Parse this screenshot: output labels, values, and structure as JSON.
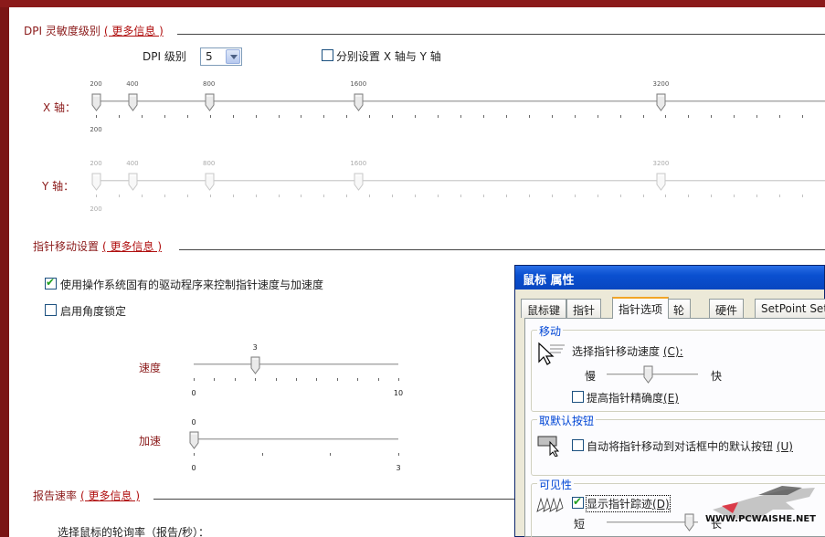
{
  "dpi_section": {
    "title": "DPI 灵敏度级别",
    "more_info": "( 更多信息 )",
    "dpi_level_label": "DPI 级别",
    "dpi_level_value": "5",
    "separate_axes_label": "分别设置 X 轴与 Y 轴",
    "separate_axes_checked": false,
    "x_axis_label": "X 轴：",
    "y_axis_label": "Y 轴：",
    "x_stops": [
      {
        "label": "200",
        "position": 0.0
      },
      {
        "label": "400",
        "position": 0.05
      },
      {
        "label": "800",
        "position": 0.155
      },
      {
        "label": "1600",
        "position": 0.36
      },
      {
        "label": "3200",
        "position": 0.775
      }
    ],
    "y_stops": [
      {
        "label": "200",
        "position": 0.0
      },
      {
        "label": "400",
        "position": 0.05
      },
      {
        "label": "800",
        "position": 0.155
      },
      {
        "label": "1600",
        "position": 0.36
      },
      {
        "label": "3200",
        "position": 0.775
      }
    ],
    "x_min_label": "200",
    "y_min_label": "200"
  },
  "pointer_section": {
    "title": "指针移动设置",
    "more_info": "( 更多信息 )",
    "use_os_driver_label": "使用操作系统固有的驱动程序来控制指针速度与加速度",
    "use_os_driver_checked": true,
    "angle_lock_label": "启用角度锁定",
    "angle_lock_checked": false,
    "speed": {
      "label": "速度",
      "value": 3,
      "value_label": "3",
      "min": 0,
      "max": 10,
      "min_label": "0",
      "max_label": "10"
    },
    "acceleration": {
      "label": "加速",
      "value": 0,
      "value_label": "0",
      "min": 0,
      "max": 3,
      "min_label": "0",
      "max_label": "3"
    }
  },
  "report_section": {
    "title": "报告速率",
    "more_info": "( 更多信息 )",
    "poll_rate_label": "选择鼠标的轮询率（报告/秒）："
  },
  "dialog": {
    "title": "鼠标 属性",
    "tabs": [
      "鼠标键",
      "指针",
      "指针选项",
      "轮",
      "硬件",
      "SetPoint Set"
    ],
    "active_tab": "指针选项",
    "motion_group": "移动",
    "select_speed_label": "选择指针移动速度",
    "select_speed_key": "(C):",
    "slow_label": "慢",
    "fast_label": "快",
    "speed_level": 0.45,
    "enhance_precision_label": "提高指针精确度",
    "enhance_precision_key": "(E)",
    "enhance_precision_checked": false,
    "snap_group": "取默认按钮",
    "snap_label": "自动将指针移动到对话框中的默认按钮",
    "snap_key": "(U)",
    "snap_checked": false,
    "visibility_group": "可见性",
    "trails_label": "显示指针踪迹",
    "trails_key": "(D)",
    "trails_checked": true,
    "short_label": "短",
    "long_label": "长",
    "trail_level": 0.9
  },
  "watermark": {
    "text": "WWW.PCWAISHE.NET"
  },
  "colors": {
    "accent_red": "#8b1a1a",
    "xp_blue": "#0a50d0",
    "group_blue": "#0046d5"
  }
}
